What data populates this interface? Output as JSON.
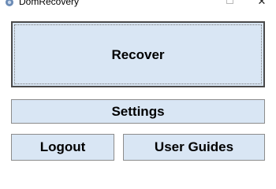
{
  "window": {
    "title": "DomRecovery",
    "app_icon": "app-logo-icon",
    "maximize_icon": "maximize-icon",
    "close_glyph": "✕"
  },
  "buttons": {
    "recover_label": "Recover",
    "settings_label": "Settings",
    "logout_label": "Logout",
    "user_guides_label": "User Guides"
  },
  "colors": {
    "button_fill": "#d9e6f4",
    "button_border": "#8c8c8c",
    "focused_border": "#4a4a4a"
  }
}
